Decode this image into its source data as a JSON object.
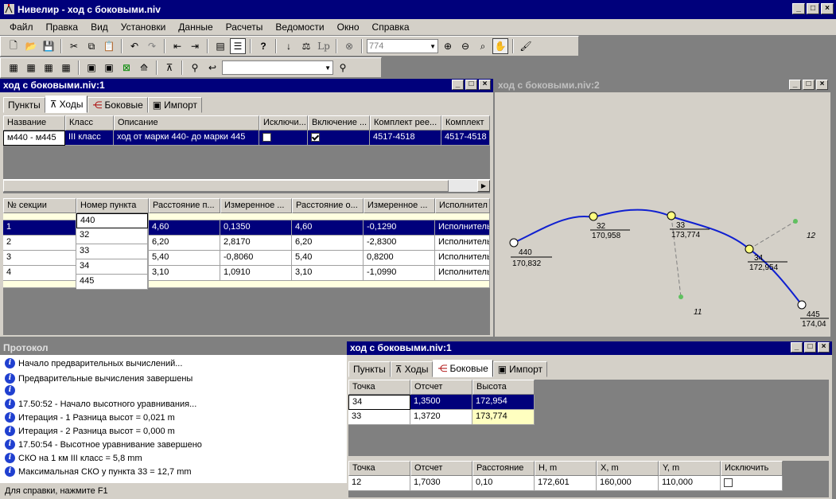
{
  "app": {
    "title": "Нивелир - ход с боковыми.niv"
  },
  "menu": [
    "Файл",
    "Правка",
    "Вид",
    "Установки",
    "Данные",
    "Расчеты",
    "Ведомости",
    "Окно",
    "Справка"
  ],
  "toolbar": {
    "zoom_value": "774"
  },
  "win1": {
    "title": "ход с боковыми.niv:1",
    "tabs": [
      "Пункты",
      "Ходы",
      "Боковые",
      "Импорт"
    ],
    "upper_columns": [
      "Название",
      "Класс",
      "Описание",
      "Исключи...",
      "Включение ...",
      "Комплект рее...",
      "Комплект"
    ],
    "upper_row": {
      "name": "м440 - м445",
      "class": "III класс",
      "desc": "ход от марки  440- до марки 445",
      "exclude": false,
      "include": true,
      "kit1": "4517-4518",
      "kit2": "4517-4518"
    },
    "lower_columns": [
      "№ секции",
      "Номер пункта",
      "Расстояние п...",
      "Измеренное ...",
      "Расстояние о...",
      "Измеренное ...",
      "Исполнител"
    ],
    "points": [
      "440",
      "32",
      "33",
      "34",
      "445"
    ],
    "sections": [
      {
        "n": "1",
        "d1": "4,60",
        "h1": "0,1350",
        "d2": "4,60",
        "h2": "-0,1290",
        "exec": "Исполнитель"
      },
      {
        "n": "2",
        "d1": "6,20",
        "h1": "2,8170",
        "d2": "6,20",
        "h2": "-2,8300",
        "exec": "Исполнитель"
      },
      {
        "n": "3",
        "d1": "5,40",
        "h1": "-0,8060",
        "d2": "5,40",
        "h2": "0,8200",
        "exec": "Исполнитель"
      },
      {
        "n": "4",
        "d1": "3,10",
        "h1": "1,0910",
        "d2": "3,10",
        "h2": "-1,0990",
        "exec": "Исполнитель"
      }
    ]
  },
  "win2": {
    "title": "ход с боковыми.niv:2",
    "stations": [
      {
        "name": "440",
        "height": "170,832"
      },
      {
        "name": "32",
        "height": "170,958"
      },
      {
        "name": "33",
        "height": "173,774"
      },
      {
        "name": "34",
        "height": "172,954"
      },
      {
        "name": "445",
        "height": "174,04"
      }
    ],
    "side_labels": [
      "12",
      "11"
    ]
  },
  "protocol": {
    "title": "Протокол",
    "lines": [
      "Начало предварительных вычислений...",
      "Предварительные вычисления завершены",
      "",
      "17.50:52 - Начало высотного уравнивания...",
      "Итерация - 1   Разница высот = 0,021 m",
      "Итерация - 2   Разница высот = 0,000 m",
      "17.50:54 - Высотное уравнивание завершено",
      "СКО на 1 км III класс = 5,8 mm",
      "Максимальная СКО у пункта 33 = 12,7 mm"
    ]
  },
  "win3": {
    "title": "ход с боковыми.niv:1",
    "tabs": [
      "Пункты",
      "Ходы",
      "Боковые",
      "Импорт"
    ],
    "upper_columns": [
      "Точка",
      "Отсчет",
      "Высота"
    ],
    "upper_rows": [
      {
        "p": "34",
        "r": "1,3500",
        "h": "172,954"
      },
      {
        "p": "33",
        "r": "1,3720",
        "h": "173,774"
      }
    ],
    "lower_columns": [
      "Точка",
      "Отсчет",
      "Расстояние",
      "H, m",
      "X, m",
      "Y, m",
      "Исключить"
    ],
    "lower_row": {
      "p": "12",
      "r": "1,7030",
      "d": "0,10",
      "h": "172,601",
      "x": "160,000",
      "y": "110,000",
      "excl": false
    }
  },
  "status": "Для справки, нажмите F1"
}
